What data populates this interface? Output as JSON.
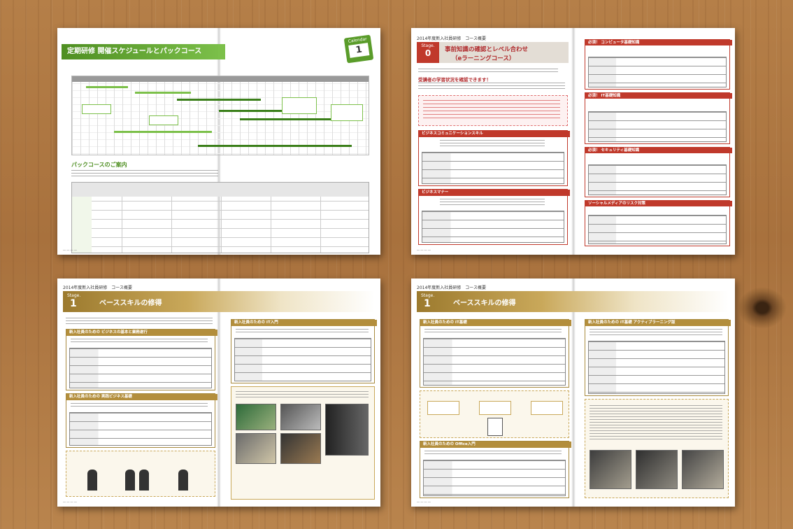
{
  "spread1": {
    "title": "定期研修 開催スケジュールとパックコース",
    "calendar_tab": "Calendar",
    "calendar_num": "1",
    "section": "パックコースのご案内"
  },
  "spread2": {
    "header": "2014年度新入社員研修　コース概要",
    "stage_label": "Stage.",
    "stage_num": "0",
    "title": "事前知識の確認とレベル合わせ",
    "subtitle": "（eラーニングコース）",
    "lead": "受講者の学習状況を確認できます！",
    "box1": "ビジネスコミュニケーションスキル",
    "box2": "ビジネスマナー",
    "right1": "必須！ コンピュータ基礎知識",
    "right2": "必須！ IT基礎知識",
    "right3": "必須！ セキュリティ基礎知識",
    "right4": "ソーシャルメディアのリスク対策",
    "label_course": "コースコード",
    "label_schedule": "スケジュール",
    "label_service": "サービス"
  },
  "spread3": {
    "header": "2014年度新入社員研修　コース概要",
    "stage_label": "Stage.",
    "stage_num": "1",
    "title": "ベーススキルの修得",
    "box1": "新入社員のための ビジネスの基本と業務遂行",
    "box2": "新入社員のための 実践ビジネス基礎",
    "box3": "新入社員のための IT入門",
    "label_course": "コースコード",
    "label_schedule": "スケジュール",
    "label_service": "サービス"
  },
  "spread4": {
    "header": "2014年度新入社員研修　コース概要",
    "stage_label": "Stage.",
    "stage_num": "1",
    "title": "ベーススキルの修得",
    "box1": "新入社員のための IT基礎",
    "box2": "新入社員のための Office入門",
    "box3": "新入社員のための IT基礎 アクティブラーニング版",
    "label_course": "コースコード",
    "label_schedule": "スケジュール",
    "label_service": "サービス"
  },
  "colors": {
    "green": "#5a9c2a",
    "red": "#c0392b",
    "gold": "#b38e3c",
    "wood": "#b57f48"
  }
}
